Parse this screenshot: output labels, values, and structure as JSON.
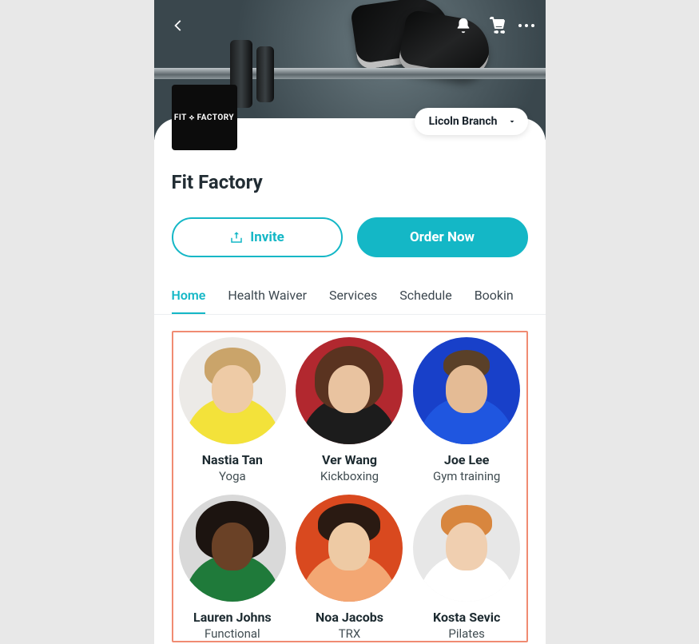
{
  "logo_text": "FIT ⟡ FACTORY",
  "branch": {
    "label": "Licoln Branch"
  },
  "business_name": "Fit Factory",
  "buttons": {
    "invite": "Invite",
    "order_now": "Order Now"
  },
  "tabs": [
    {
      "id": "home",
      "label": "Home",
      "active": true
    },
    {
      "id": "health-waiver",
      "label": "Health Waiver",
      "active": false
    },
    {
      "id": "services",
      "label": "Services",
      "active": false
    },
    {
      "id": "schedule",
      "label": "Schedule",
      "active": false
    },
    {
      "id": "bookings",
      "label": "Bookin",
      "active": false
    }
  ],
  "staff": [
    {
      "name": "Nastia Tan",
      "role": "Yoga"
    },
    {
      "name": "Ver Wang",
      "role": "Kickboxing"
    },
    {
      "name": "Joe Lee",
      "role": "Gym training"
    },
    {
      "name": "Lauren Johns",
      "role": "Functional"
    },
    {
      "name": "Noa Jacobs",
      "role": "TRX"
    },
    {
      "name": "Kosta Sevic",
      "role": "Pilates"
    }
  ]
}
